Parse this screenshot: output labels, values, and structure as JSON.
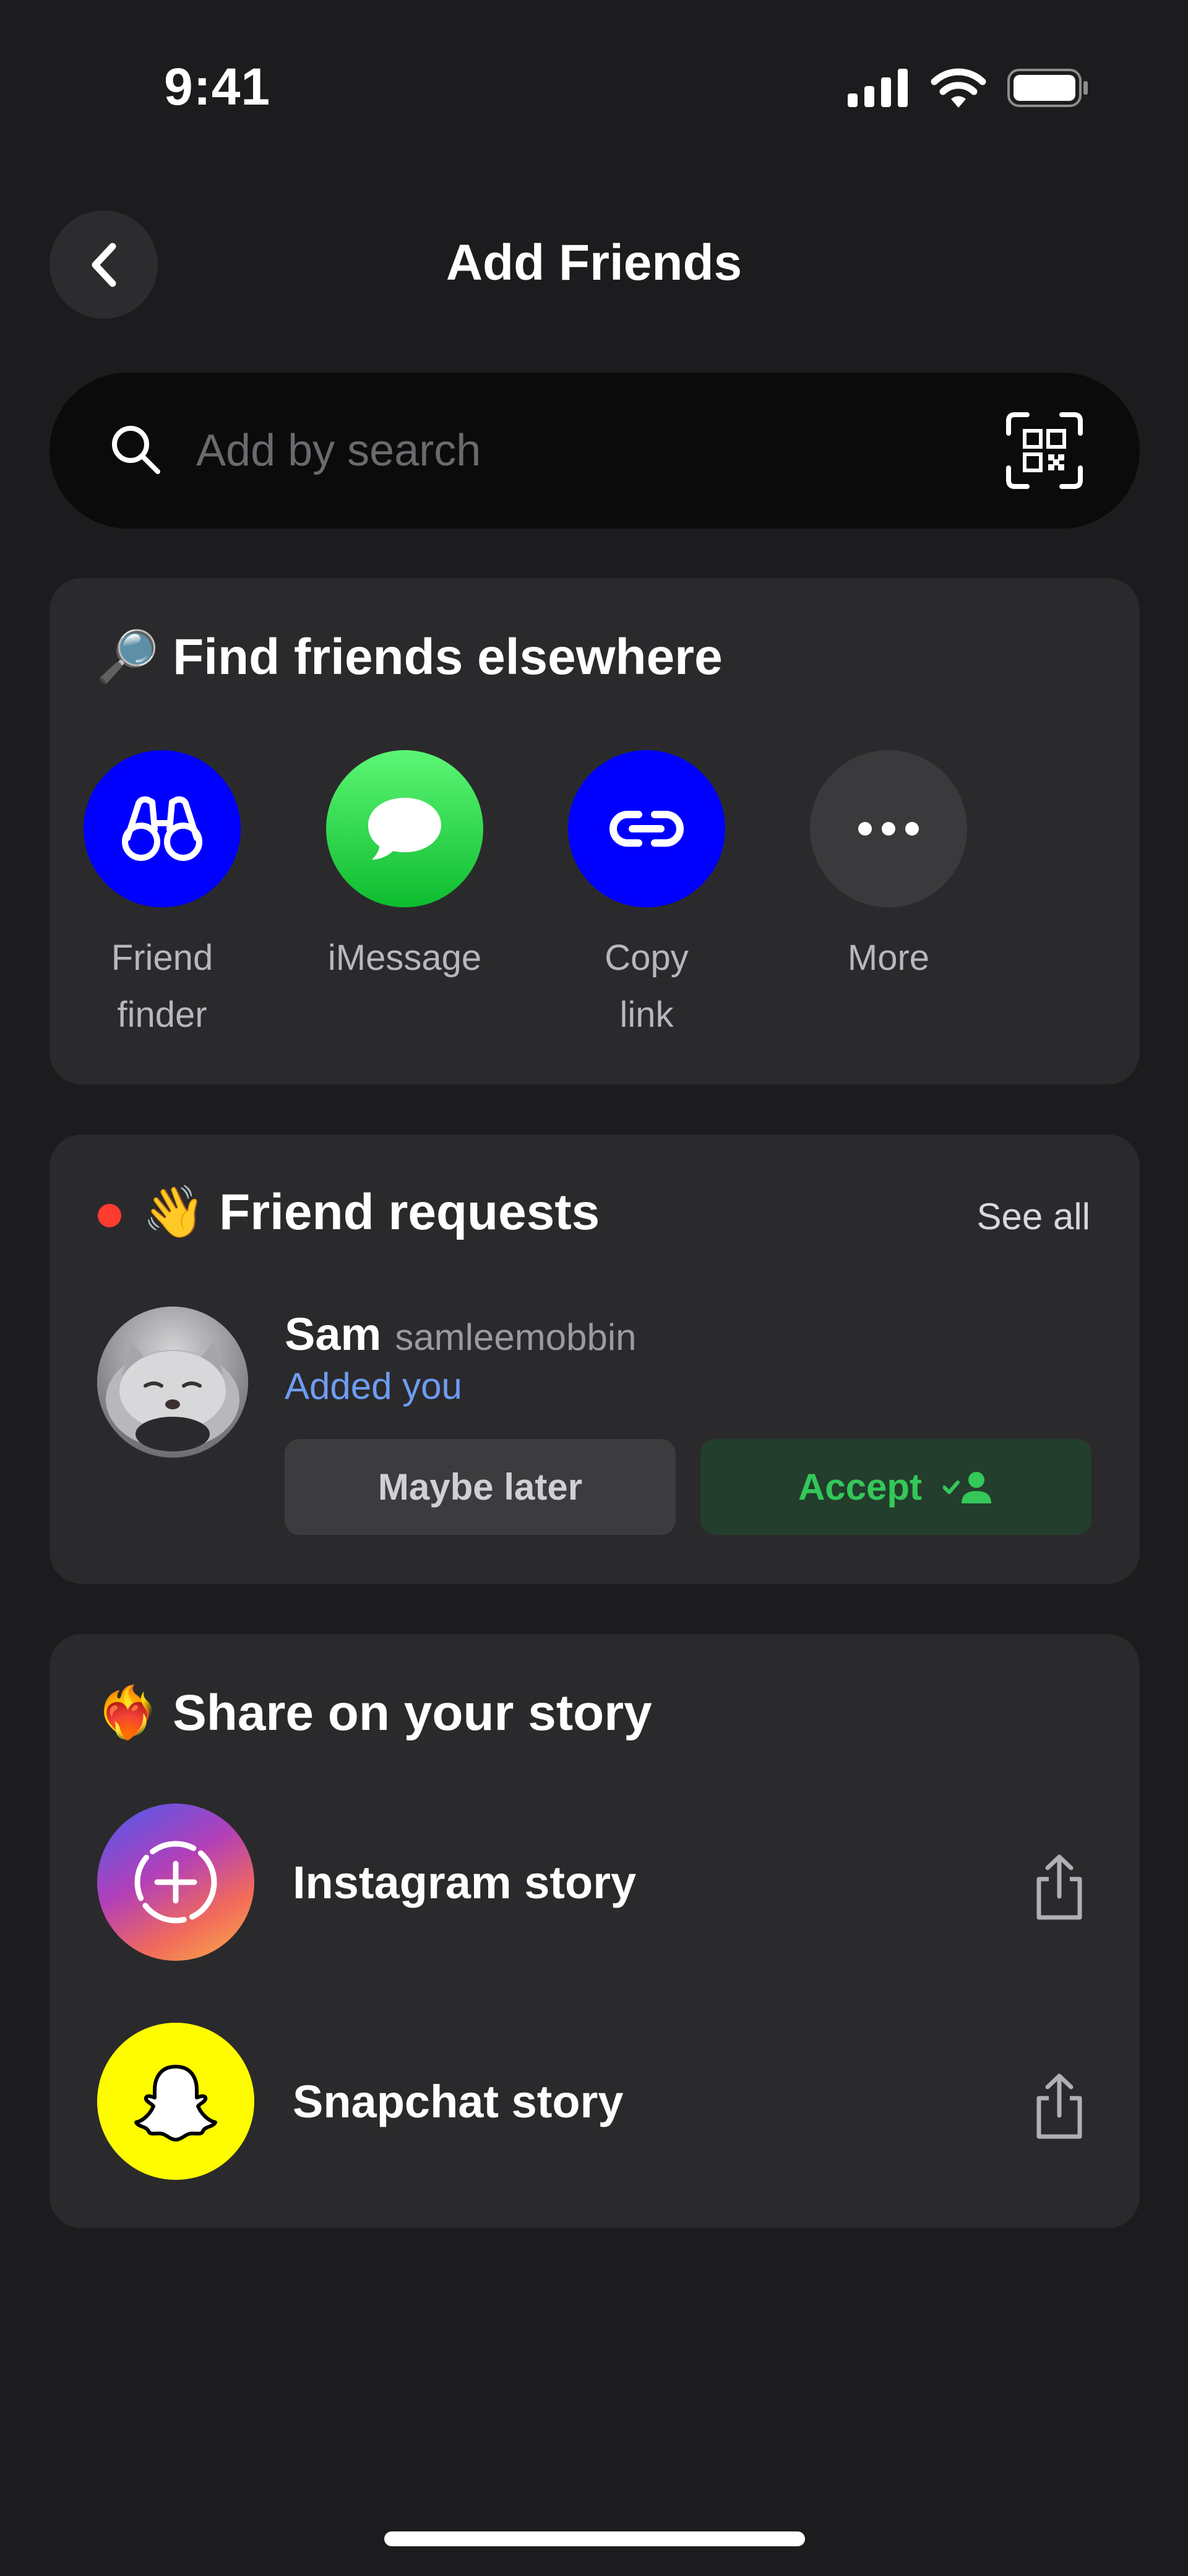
{
  "status_bar": {
    "time": "9:41"
  },
  "header": {
    "title": "Add Friends"
  },
  "search": {
    "placeholder": "Add by search"
  },
  "find_friends": {
    "emoji": "🔎",
    "title": "Find friends elsewhere",
    "options": [
      {
        "line1": "Friend",
        "line2": "finder",
        "color": "#0000ff",
        "icon": "binoculars-icon"
      },
      {
        "line1": "iMessage",
        "line2": "",
        "color": "#32c744",
        "icon": "message-bubble-icon"
      },
      {
        "line1": "Copy",
        "line2": "link",
        "color": "#0000ff",
        "icon": "link-icon"
      },
      {
        "line1": "More",
        "line2": "",
        "color": "#3a3a3c",
        "icon": "more-dots-icon"
      }
    ]
  },
  "friend_requests": {
    "emoji": "👋",
    "title": "Friend requests",
    "see_all": "See all",
    "request": {
      "name": "Sam",
      "handle": "samleemobbin",
      "status": "Added you",
      "decline_label": "Maybe later",
      "accept_label": "Accept"
    }
  },
  "share_story": {
    "emoji": "❤️‍🔥",
    "title": "Share on your story",
    "items": [
      {
        "label": "Instagram story",
        "icon": "instagram-story-icon"
      },
      {
        "label": "Snapchat story",
        "icon": "snapchat-ghost-icon",
        "color": "#fffc00"
      }
    ]
  },
  "colors": {
    "background": "#1c1c1e",
    "card": "#2a2a2c",
    "accent_blue": "#0000ff",
    "accept_green": "#34c759",
    "added_you_blue": "#6f9cf3",
    "notification_red": "#ff3b30"
  }
}
